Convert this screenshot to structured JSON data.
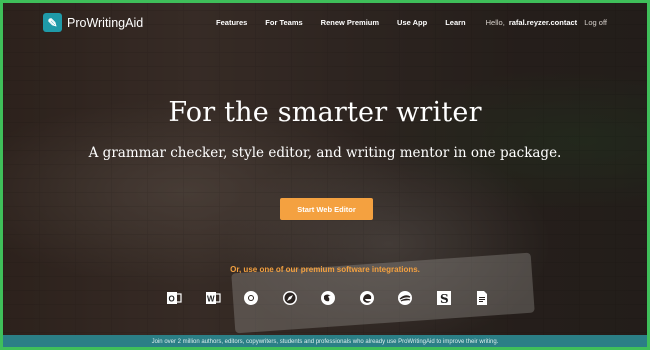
{
  "brand": {
    "name": "ProWritingAid"
  },
  "nav": {
    "links": [
      "Features",
      "For Teams",
      "Renew Premium",
      "Use App",
      "Learn"
    ],
    "hello": "Hello,",
    "username": "rafal.reyzer.contact",
    "logoff": "Log off"
  },
  "hero": {
    "headline": "For the smarter writer",
    "subheadline": "A grammar checker, style editor, and writing mentor in one package.",
    "cta": "Start Web Editor",
    "integrations_text": "Or, use one of our premium software integrations.",
    "integrations": [
      "outlook-icon",
      "word-icon",
      "chrome-icon",
      "safari-icon",
      "firefox-icon",
      "edge-icon",
      "openoffice-icon",
      "scrivener-icon",
      "google-docs-icon"
    ]
  },
  "footer": {
    "text": "Join over 2 million authors, editors, copywriters, students and professionals who already use ProWritingAid to improve their writing."
  },
  "colors": {
    "accent": "#f4a140",
    "brand": "#1f9aa8",
    "footer": "#2b7f86",
    "frame": "#3fbf5a"
  }
}
